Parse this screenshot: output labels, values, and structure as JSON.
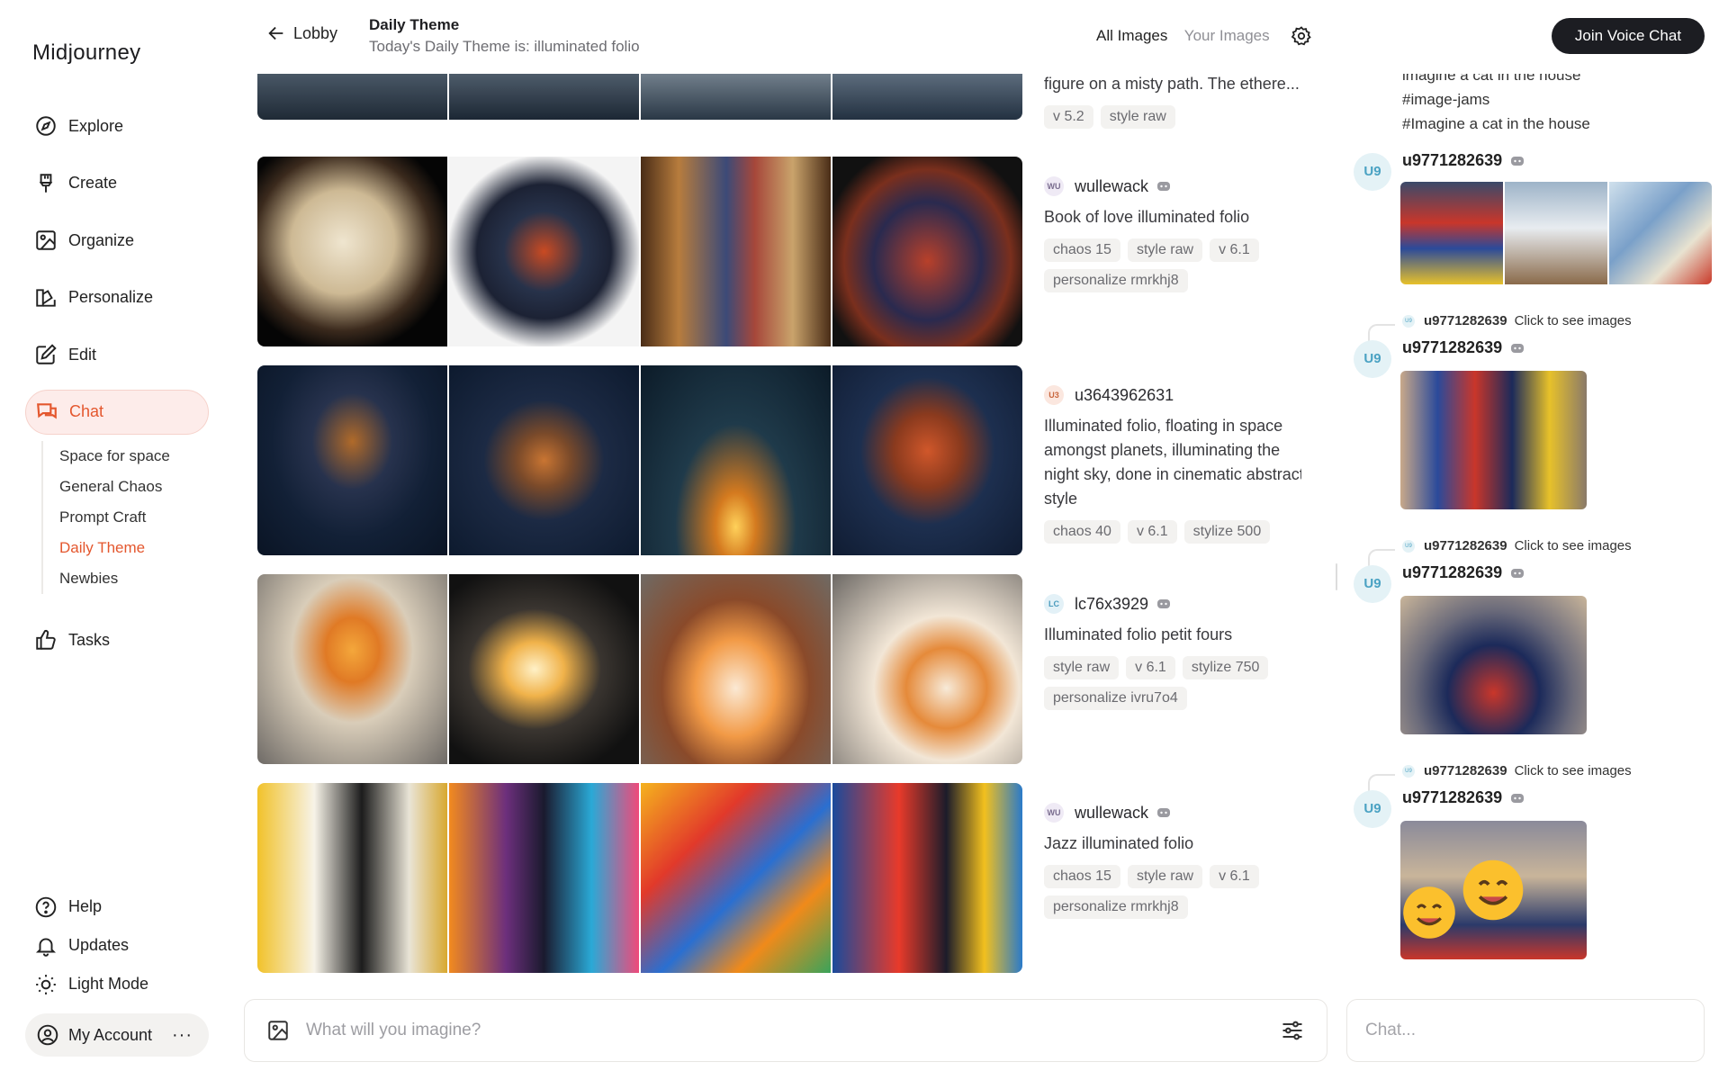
{
  "brand": "Midjourney",
  "nav": {
    "explore": "Explore",
    "create": "Create",
    "organize": "Organize",
    "personalize": "Personalize",
    "edit": "Edit",
    "chat": "Chat",
    "tasks": "Tasks"
  },
  "subnav": [
    "Space for space",
    "General Chaos",
    "Prompt Craft",
    "Daily Theme",
    "Newbies"
  ],
  "bottom": {
    "help": "Help",
    "updates": "Updates",
    "light": "Light Mode",
    "account": "My Account",
    "dots": "···"
  },
  "header": {
    "back": "Lobby",
    "title": "Daily Theme",
    "subtitle": "Today's Daily Theme is: illuminated folio",
    "all": "All Images",
    "yours": "Your Images",
    "voice": "Join Voice Chat"
  },
  "feed": {
    "top": {
      "prompt": "figure on a misty path. The ethere...",
      "tags": [
        "v 5.2",
        "style raw"
      ]
    },
    "posts": [
      {
        "initials": "WU",
        "user": "wullewack",
        "prompt": "Book of love illuminated folio",
        "tags": [
          "chaos 15",
          "style raw",
          "v 6.1",
          "personalize rmrkhj8"
        ]
      },
      {
        "initials": "U3",
        "user": "u3643962631",
        "prompt": "Illuminated folio, floating in space amongst planets, illuminating the night sky, done in cinematic abstract style",
        "tags": [
          "chaos 40",
          "v 6.1",
          "stylize 500"
        ]
      },
      {
        "initials": "LC",
        "user": "lc76x3929",
        "prompt": "Illuminated folio petit fours",
        "tags": [
          "style raw",
          "v 6.1",
          "stylize 750",
          "personalize ivru7o4"
        ]
      },
      {
        "initials": "WU",
        "user": "wullewack",
        "prompt": "Jazz illuminated folio",
        "tags": [
          "chaos 15",
          "style raw",
          "v 6.1",
          "personalize rmrkhj8"
        ]
      }
    ]
  },
  "chat": {
    "top_lines": [
      "imagine a cat in the house",
      "#image-jams",
      "#Imagine a cat in the house"
    ],
    "avatar": "U9",
    "user": "u9771282639",
    "reply_hint": "Click to see images",
    "mini": "U9"
  },
  "input": {
    "imagine_placeholder": "What will you imagine?",
    "chat_placeholder": "Chat..."
  }
}
